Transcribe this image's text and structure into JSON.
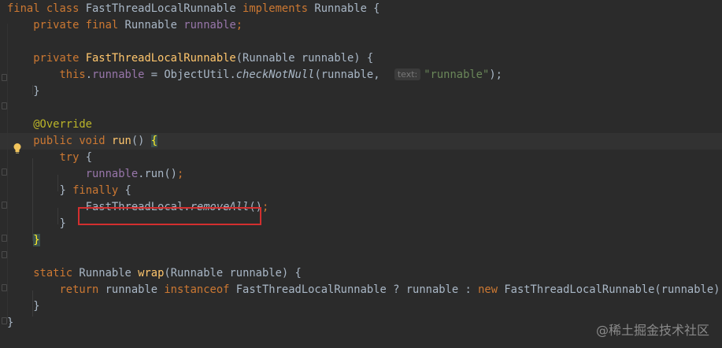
{
  "editor": {
    "lines": [
      {
        "t": [
          {
            "c": "kw",
            "v": "final class "
          },
          {
            "c": "plain",
            "v": "FastThreadLocalRunnable "
          },
          {
            "c": "kw",
            "v": "implements "
          },
          {
            "c": "plain",
            "v": "Runnable {"
          }
        ]
      },
      {
        "t": [
          {
            "c": "plain",
            "v": "    "
          },
          {
            "c": "kw",
            "v": "private final "
          },
          {
            "c": "plain",
            "v": "Runnable "
          },
          {
            "c": "fld",
            "v": "runnable"
          },
          {
            "c": "kw",
            "v": ";"
          }
        ]
      },
      {
        "t": []
      },
      {
        "t": [
          {
            "c": "plain",
            "v": "    "
          },
          {
            "c": "kw",
            "v": "private "
          },
          {
            "c": "fn",
            "v": "FastThreadLocalRunnable"
          },
          {
            "c": "plain",
            "v": "(Runnable runnable) {"
          }
        ]
      },
      {
        "t": [
          {
            "c": "plain",
            "v": "        "
          },
          {
            "c": "kw",
            "v": "this"
          },
          {
            "c": "plain",
            "v": "."
          },
          {
            "c": "fld",
            "v": "runnable "
          },
          {
            "c": "plain",
            "v": "= ObjectUtil."
          },
          {
            "c": "plain it",
            "v": "checkNotNull"
          },
          {
            "c": "plain",
            "v": "(runnable, "
          },
          {
            "c": "hint",
            "v": "text:"
          },
          {
            "c": "str",
            "v": "\"runnable\""
          },
          {
            "c": "plain",
            "v": ");"
          }
        ]
      },
      {
        "t": [
          {
            "c": "plain",
            "v": "    }"
          }
        ]
      },
      {
        "t": []
      },
      {
        "t": [
          {
            "c": "plain",
            "v": "    "
          },
          {
            "c": "ann",
            "v": "@Override"
          }
        ]
      },
      {
        "t": [
          {
            "c": "plain",
            "v": "    "
          },
          {
            "c": "kw",
            "v": "public void "
          },
          {
            "c": "fn",
            "v": "run"
          },
          {
            "c": "plain",
            "v": "() "
          },
          {
            "c": "brace-hl",
            "v": "{"
          }
        ],
        "caret": true
      },
      {
        "t": [
          {
            "c": "plain",
            "v": "        "
          },
          {
            "c": "kw",
            "v": "try "
          },
          {
            "c": "plain",
            "v": "{"
          }
        ]
      },
      {
        "t": [
          {
            "c": "plain",
            "v": "            "
          },
          {
            "c": "fld",
            "v": "runnable"
          },
          {
            "c": "plain",
            "v": ".run()"
          },
          {
            "c": "kw",
            "v": ";"
          }
        ]
      },
      {
        "t": [
          {
            "c": "plain",
            "v": "        } "
          },
          {
            "c": "kw",
            "v": "finally "
          },
          {
            "c": "plain",
            "v": "{"
          }
        ]
      },
      {
        "t": [
          {
            "c": "plain",
            "v": "            FastThreadLocal."
          },
          {
            "c": "plain it",
            "v": "removeAll"
          },
          {
            "c": "plain",
            "v": "()"
          },
          {
            "c": "kw",
            "v": ";"
          }
        ]
      },
      {
        "t": [
          {
            "c": "plain",
            "v": "        }"
          }
        ]
      },
      {
        "t": [
          {
            "c": "plain",
            "v": "    "
          },
          {
            "c": "brace-hl",
            "v": "}"
          }
        ]
      },
      {
        "t": []
      },
      {
        "t": [
          {
            "c": "plain",
            "v": "    "
          },
          {
            "c": "kw",
            "v": "static "
          },
          {
            "c": "plain",
            "v": "Runnable "
          },
          {
            "c": "fn",
            "v": "wrap"
          },
          {
            "c": "plain",
            "v": "(Runnable runnable) {"
          }
        ]
      },
      {
        "t": [
          {
            "c": "plain",
            "v": "        "
          },
          {
            "c": "kw",
            "v": "return "
          },
          {
            "c": "plain",
            "v": "runnable "
          },
          {
            "c": "kw",
            "v": "instanceof "
          },
          {
            "c": "plain",
            "v": "FastThreadLocalRunnable ? runnable : "
          },
          {
            "c": "kw",
            "v": "new "
          },
          {
            "c": "plain",
            "v": "FastThreadLocalRunnable(runnable)"
          },
          {
            "c": "kw",
            "v": ";"
          }
        ]
      },
      {
        "t": [
          {
            "c": "plain",
            "v": "    }"
          }
        ]
      },
      {
        "t": [
          {
            "c": "plain",
            "v": "}"
          }
        ]
      }
    ]
  },
  "watermark": "@稀土掘金技术社区"
}
